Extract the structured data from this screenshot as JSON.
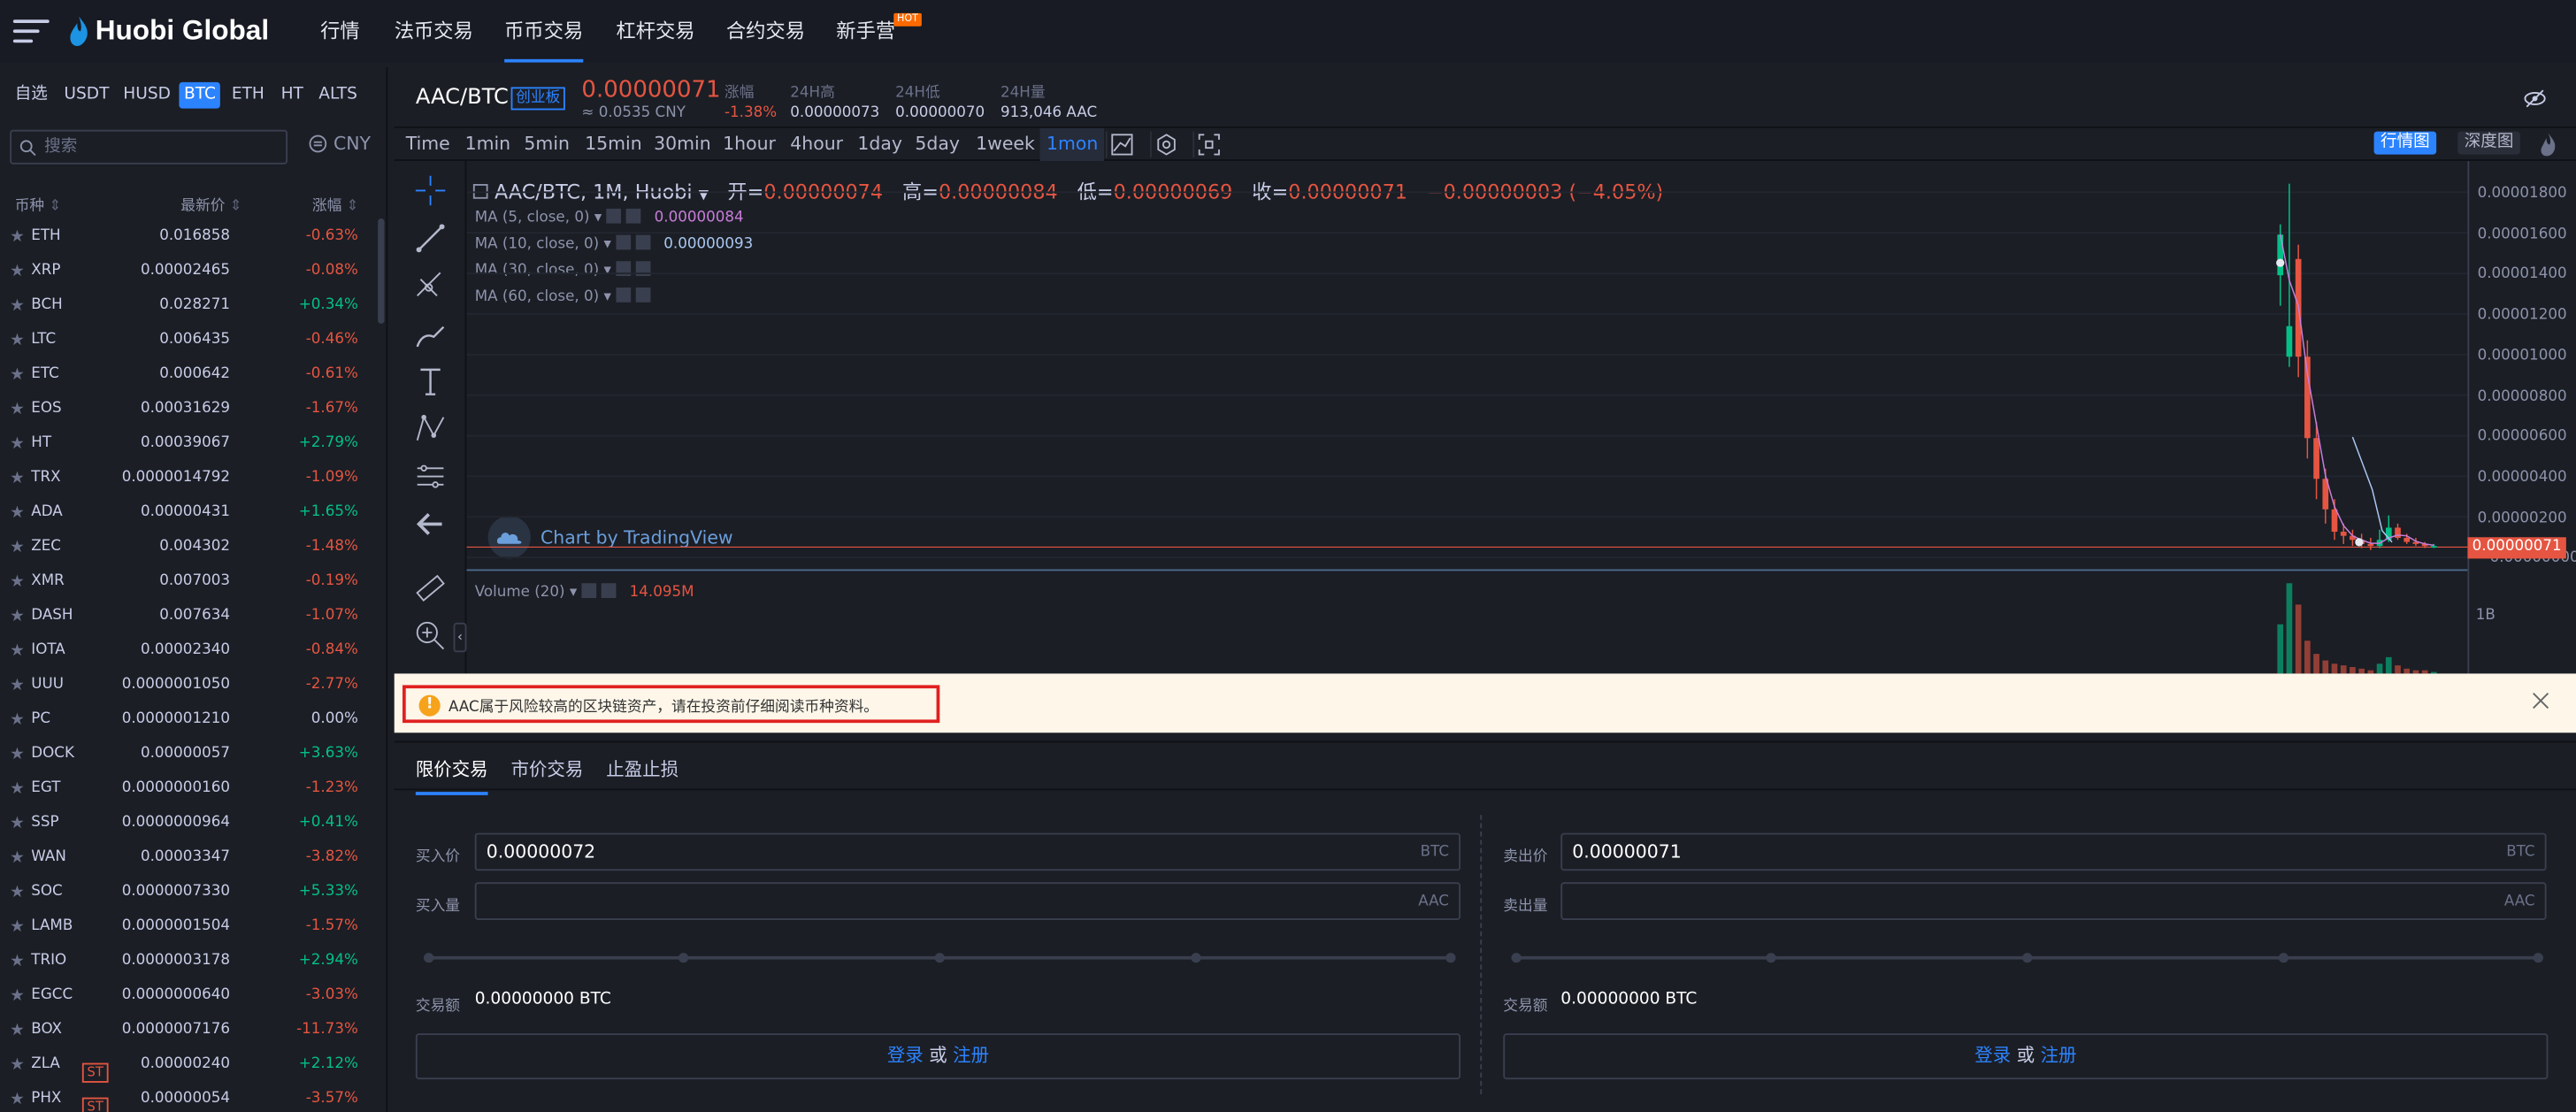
{
  "header": {
    "logo": "Huobi Global",
    "nav": [
      {
        "label": "行情"
      },
      {
        "label": "法币交易"
      },
      {
        "label": "币币交易"
      },
      {
        "label": "杠杆交易"
      },
      {
        "label": "合约交易"
      },
      {
        "label": "新手营"
      }
    ],
    "hot_badge": "HOT"
  },
  "sidebar": {
    "quote_tabs": [
      "自选",
      "USDT",
      "HUSD",
      "BTC",
      "ETH",
      "HT",
      "ALTS"
    ],
    "active_quote": "BTC",
    "search_placeholder": "搜索",
    "currency": "CNY",
    "columns": {
      "coin": "币种",
      "price": "最新价",
      "change": "涨幅"
    },
    "rows": [
      {
        "sym": "ETH",
        "price": "0.016858",
        "chg": "-0.63%",
        "up": false
      },
      {
        "sym": "XRP",
        "price": "0.00002465",
        "chg": "-0.08%",
        "up": false
      },
      {
        "sym": "BCH",
        "price": "0.028271",
        "chg": "+0.34%",
        "up": true
      },
      {
        "sym": "LTC",
        "price": "0.006435",
        "chg": "-0.46%",
        "up": false
      },
      {
        "sym": "ETC",
        "price": "0.000642",
        "chg": "-0.61%",
        "up": false
      },
      {
        "sym": "EOS",
        "price": "0.00031629",
        "chg": "-1.67%",
        "up": false
      },
      {
        "sym": "HT",
        "price": "0.00039067",
        "chg": "+2.79%",
        "up": true
      },
      {
        "sym": "TRX",
        "price": "0.0000014792",
        "chg": "-1.09%",
        "up": false
      },
      {
        "sym": "ADA",
        "price": "0.00000431",
        "chg": "+1.65%",
        "up": true
      },
      {
        "sym": "ZEC",
        "price": "0.004302",
        "chg": "-1.48%",
        "up": false
      },
      {
        "sym": "XMR",
        "price": "0.007003",
        "chg": "-0.19%",
        "up": false
      },
      {
        "sym": "DASH",
        "price": "0.007634",
        "chg": "-1.07%",
        "up": false
      },
      {
        "sym": "IOTA",
        "price": "0.00002340",
        "chg": "-0.84%",
        "up": false
      },
      {
        "sym": "UUU",
        "price": "0.0000001050",
        "chg": "-2.77%",
        "up": false
      },
      {
        "sym": "PC",
        "price": "0.0000001210",
        "chg": "0.00%",
        "up": null
      },
      {
        "sym": "DOCK",
        "price": "0.00000057",
        "chg": "+3.63%",
        "up": true
      },
      {
        "sym": "EGT",
        "price": "0.0000000160",
        "chg": "-1.23%",
        "up": false
      },
      {
        "sym": "SSP",
        "price": "0.0000000964",
        "chg": "+0.41%",
        "up": true
      },
      {
        "sym": "WAN",
        "price": "0.00003347",
        "chg": "-3.82%",
        "up": false
      },
      {
        "sym": "SOC",
        "price": "0.0000007330",
        "chg": "+5.33%",
        "up": true
      },
      {
        "sym": "LAMB",
        "price": "0.0000001504",
        "chg": "-1.57%",
        "up": false
      },
      {
        "sym": "TRIO",
        "price": "0.0000003178",
        "chg": "+2.94%",
        "up": true
      },
      {
        "sym": "EGCC",
        "price": "0.0000000640",
        "chg": "-3.03%",
        "up": false
      },
      {
        "sym": "BOX",
        "price": "0.0000007176",
        "chg": "-11.73%",
        "up": false
      },
      {
        "sym": "ZLA",
        "price": "0.00000240",
        "chg": "+2.12%",
        "up": true,
        "tag": "ST"
      },
      {
        "sym": "PHX",
        "price": "0.00000054",
        "chg": "-3.57%",
        "up": false,
        "tag": "ST"
      }
    ]
  },
  "ticker": {
    "pair": "AAC/BTC",
    "board": "创业板",
    "last": "0.00000071",
    "cny": "≈ 0.0535 CNY",
    "stats": [
      {
        "label": "涨幅",
        "value": "-1.38%",
        "color": "red"
      },
      {
        "label": "24H高",
        "value": "0.00000073"
      },
      {
        "label": "24H低",
        "value": "0.00000070"
      },
      {
        "label": "24H量",
        "value": "913,046 AAC"
      }
    ]
  },
  "chart_toolbar": {
    "intervals": [
      "Time",
      "1min",
      "5min",
      "15min",
      "30min",
      "1hour",
      "4hour",
      "1day",
      "5day",
      "1week",
      "1mon"
    ],
    "active": "1mon",
    "views": [
      "行情图",
      "深度图"
    ]
  },
  "chart": {
    "legend_pair": "AAC/BTC, 1M, Huobi",
    "ohlc": [
      {
        "k": "开=",
        "v": "0.00000074"
      },
      {
        "k": "高=",
        "v": "0.00000084"
      },
      {
        "k": "低=",
        "v": "0.00000069"
      },
      {
        "k": "收=",
        "v": "0.00000071"
      }
    ],
    "change": "−0.00000003 (−4.05%)",
    "ma": [
      {
        "label": "MA (5, close, 0)",
        "value": "0.00000084",
        "color": "#c77dd9"
      },
      {
        "label": "MA (10, close, 0)",
        "value": "0.00000093",
        "color": "#a9c7f0"
      },
      {
        "label": "MA (30, close, 0)",
        "value": ""
      },
      {
        "label": "MA (60, close, 0)",
        "value": ""
      }
    ],
    "watermark": "Chart by TradingView",
    "volume_label": "Volume (20)",
    "volume_value": "14.095M",
    "axis": [
      "0.00001800",
      "0.00001600",
      "0.00001400",
      "0.00001200",
      "0.00001000",
      "0.00000800",
      "0.00000600",
      "0.00000400",
      "0.00000200",
      "−0.00000000"
    ],
    "vol_axis": "1B",
    "price_label": "0.00000071"
  },
  "chart_data": {
    "type": "candlestick",
    "ylim": [
      0,
      1.9e-05
    ],
    "candles": [
      {
        "o": 1.4e-05,
        "c": 1.6e-05,
        "h": 1.65e-05,
        "l": 1.25e-05
      },
      {
        "o": 1e-05,
        "c": 1.15e-05,
        "h": 1.85e-05,
        "l": 9.5e-06
      },
      {
        "o": 1.48e-05,
        "c": 1e-05,
        "h": 1.55e-05,
        "l": 9e-06
      },
      {
        "o": 1e-05,
        "c": 6e-06,
        "h": 1.08e-05,
        "l": 5e-06
      },
      {
        "o": 6e-06,
        "c": 4e-06,
        "h": 6.8e-06,
        "l": 3e-06
      },
      {
        "o": 4e-06,
        "c": 2.5e-06,
        "h": 4.5e-06,
        "l": 1.8e-06
      },
      {
        "o": 2.5e-06,
        "c": 1.4e-06,
        "h": 3e-06,
        "l": 1e-06
      },
      {
        "o": 1.4e-06,
        "c": 1.2e-06,
        "h": 1.8e-06,
        "l": 8e-07
      },
      {
        "o": 1.2e-06,
        "c": 1e-06,
        "h": 1.5e-06,
        "l": 7e-07
      },
      {
        "o": 1e-06,
        "c": 8e-07,
        "h": 1.3e-06,
        "l": 6e-07
      },
      {
        "o": 8e-07,
        "c": 7e-07,
        "h": 1.1e-06,
        "l": 5e-07
      },
      {
        "o": 7e-07,
        "c": 1e-06,
        "h": 1.5e-06,
        "l": 6e-07
      },
      {
        "o": 1e-06,
        "c": 1.6e-06,
        "h": 2.2e-06,
        "l": 9e-07
      },
      {
        "o": 1.6e-06,
        "c": 1.1e-06,
        "h": 1.8e-06,
        "l": 1e-06
      },
      {
        "o": 1.1e-06,
        "c": 9e-07,
        "h": 1.3e-06,
        "l": 8e-07
      },
      {
        "o": 9e-07,
        "c": 8e-07,
        "h": 1.1e-06,
        "l": 7e-07
      },
      {
        "o": 8e-07,
        "c": 7e-07,
        "h": 9e-07,
        "l": 6e-07
      },
      {
        "o": 7e-07,
        "c": 7e-07,
        "h": 8e-07,
        "l": 6e-07
      }
    ]
  },
  "warning": {
    "text": "AAC属于风险较高的区块链资产，请在投资前仔细阅读币种资料。"
  },
  "order": {
    "tabs": [
      "限价交易",
      "市价交易",
      "止盈止损"
    ],
    "buy": {
      "price_label": "买入价",
      "price": "0.00000072",
      "price_unit": "BTC",
      "amount_label": "买入量",
      "amount_unit": "AAC",
      "total_label": "交易额",
      "total": "0.00000000 BTC"
    },
    "sell": {
      "price_label": "卖出价",
      "price": "0.00000071",
      "price_unit": "BTC",
      "amount_label": "卖出量",
      "amount_unit": "AAC",
      "total_label": "交易额",
      "total": "0.00000000 BTC"
    },
    "login": "登录",
    "or": "或",
    "register": "注册"
  }
}
